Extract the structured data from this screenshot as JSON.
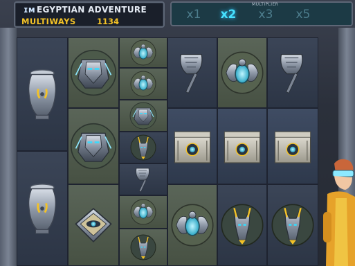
{
  "header": {
    "logo_mark": "ɪᴍ",
    "title": "EGYPTIAN ADVENTURE",
    "ways_label": "MULTIWAYS",
    "ways_value": "1134"
  },
  "multiplier": {
    "caption": "MULTIPLIER",
    "options": [
      "x1",
      "x2",
      "x3",
      "x5"
    ],
    "active": "x2"
  },
  "reels": [
    [
      "vase",
      "vase"
    ],
    [
      "pharaoh-mask",
      "pharaoh-mask",
      "eye-tablet"
    ],
    [
      "scarab",
      "scarab",
      "pharaoh-mask",
      "anubis",
      "axe",
      "scarab",
      "anubis"
    ],
    [
      "axe",
      "stone-block",
      "scarab"
    ],
    [
      "scarab",
      "stone-block",
      "anubis"
    ],
    [
      "axe",
      "stone-block",
      "anubis"
    ]
  ],
  "colors": {
    "title_text": "#e6ecf5",
    "ways_text": "#f3c227",
    "mult_active": "#47e2ff",
    "mult_inactive": "#4d7d8d"
  }
}
